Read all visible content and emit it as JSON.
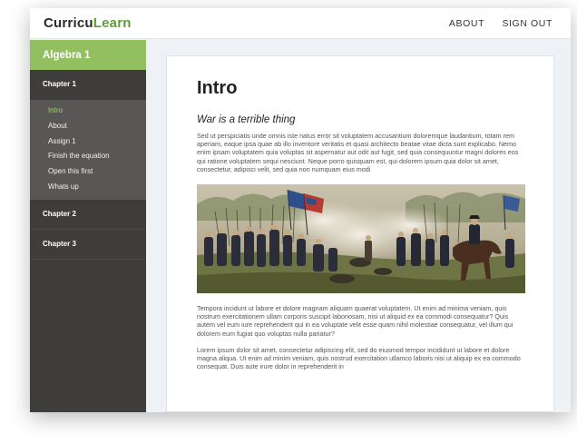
{
  "brand": {
    "part1": "Curricu",
    "part2": "Learn"
  },
  "nav": {
    "about": "ABOUT",
    "sign_out": "SIGN OUT"
  },
  "sidebar": {
    "course": "Algebra 1",
    "chapters": [
      {
        "label": "Chapter 1",
        "lessons": [
          "Intro",
          "About",
          "Assign 1",
          "Finish the equation",
          "Open this first",
          "Whats up"
        ],
        "active_lesson": "Intro"
      },
      {
        "label": "Chapter 2"
      },
      {
        "label": "Chapter 3"
      }
    ]
  },
  "main": {
    "title": "Intro",
    "subtitle": "War is a terrible thing",
    "paragraphs": [
      "Sed ut perspiciatis unde omnis iste natus error sit voluptatem accusantium doloremque laudantium, totam rem aperiam, eaque ipsa quae ab illo inventore veritatis et quasi architecto beatae vitae dicta sunt explicabo. Nemo enim ipsam voluptatem quia voluptas sit aspernatur aut odit aut fugit, sed quia consequuntur magni dolores eos qui ratione voluptatem sequi nesciunt. Neque porro quisquam est, qui dolorem ipsum quia dolor sit amet, consectetur, adipisci velit, sed quia non numquam eius modi",
      "Tempora incidunt ut labore et dolore magnam aliquam quaerat voluptatem. Ut enim ad minima veniam, quis nostrum exercitationem ullam corporis suscipit laboriosam, nisi ut aliquid ex ea commodi consequatur? Quis autem vel eum iure reprehenderit qui in ea voluptate velit esse quam nihil molestiae consequatur, vel illum qui dolorem eum fugiat quo voluptas nulla pariatur?",
      "Lorem ipsum dolor sit amet, consectetur adipiscing elit, sed do eiusmod tempor incididunt ut labore et dolore magna aliqua. Ut enim ad minim veniam, quis nostrud exercitation ullamco laboris nisi ut aliquip ex ea commodo consequat. Duis aute irure dolor in reprehenderit in"
    ],
    "image_subject": "civil-war-battle-painting"
  }
}
